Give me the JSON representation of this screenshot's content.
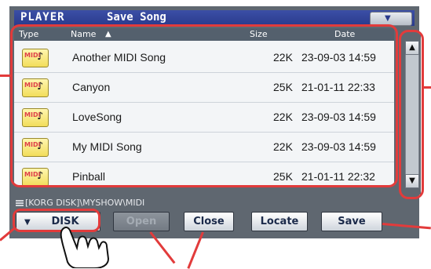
{
  "title_bar": {
    "app": "PLAYER",
    "page": "Save Song",
    "menu_icon": "triangle-down"
  },
  "list": {
    "headers": {
      "type": "Type",
      "name": "Name",
      "sort_indicator": "▲",
      "size": "Size",
      "date": "Date"
    },
    "items": [
      {
        "icon": "midi-file-icon",
        "name": "Another MIDI Song",
        "size": "22K",
        "date": "23-09-03 14:59"
      },
      {
        "icon": "midi-file-icon",
        "name": "Canyon",
        "size": "25K",
        "date": "21-01-11 22:33"
      },
      {
        "icon": "midi-file-icon",
        "name": "LoveSong",
        "size": "22K",
        "date": "23-09-03 14:59"
      },
      {
        "icon": "midi-file-icon",
        "name": "My MIDI Song",
        "size": "22K",
        "date": "23-09-03 14:59"
      },
      {
        "icon": "midi-file-icon",
        "name": "Pinball",
        "size": "25K",
        "date": "21-01-11 22:32"
      }
    ],
    "file_icon_text": {
      "midi": "MIDI",
      "note": "♪"
    }
  },
  "scrollbar": {
    "up": "▲",
    "down": "▼"
  },
  "path": {
    "text": "[KORG DISK]\\MYSHOW\\MIDI"
  },
  "buttons": {
    "disk": {
      "label": "DISK",
      "arrow": "▼"
    },
    "open": {
      "label": "Open",
      "enabled": false
    },
    "close": {
      "label": "Close"
    },
    "locate": {
      "label": "Locate"
    },
    "save": {
      "label": "Save"
    }
  },
  "colors": {
    "callout": "#e23b3b",
    "title_bar": "#2a3a8c",
    "panel": "#5f6770"
  }
}
